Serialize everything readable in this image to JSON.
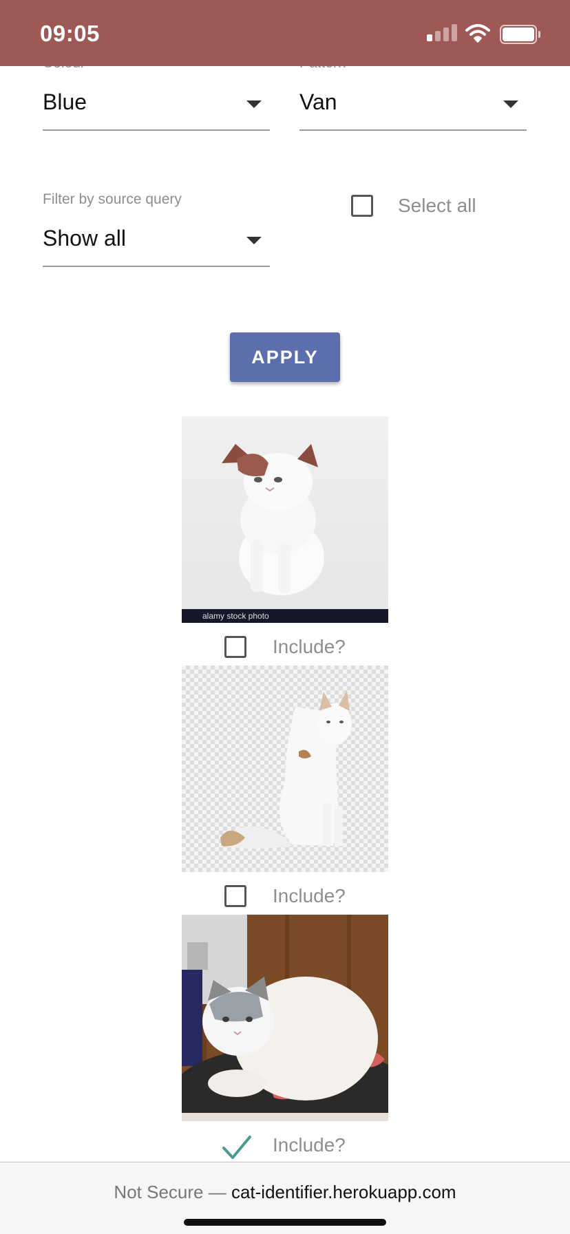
{
  "status_bar": {
    "time": "09:05",
    "icons": [
      "cellular-signal-icon",
      "wifi-icon",
      "battery-icon"
    ]
  },
  "filters": {
    "colour": {
      "label": "Colour",
      "value": "Blue"
    },
    "pattern": {
      "label": "Pattern",
      "value": "Van"
    },
    "source_query": {
      "label": "Filter by source query",
      "value": "Show all"
    },
    "select_all": {
      "label": "Select all",
      "checked": false
    }
  },
  "apply_button": {
    "label": "APPLY",
    "color": "#5d6eac"
  },
  "results": [
    {
      "include_label": "Include?",
      "checked": false,
      "watermark": "alamy stock photo"
    },
    {
      "include_label": "Include?",
      "checked": false
    },
    {
      "include_label": "Include?",
      "checked": true
    }
  ],
  "browser": {
    "security": "Not Secure —",
    "host": "cat-identifier.herokuapp.com"
  },
  "colors": {
    "status_bar": "#9e5957",
    "accent_check": "#4a9a92"
  }
}
